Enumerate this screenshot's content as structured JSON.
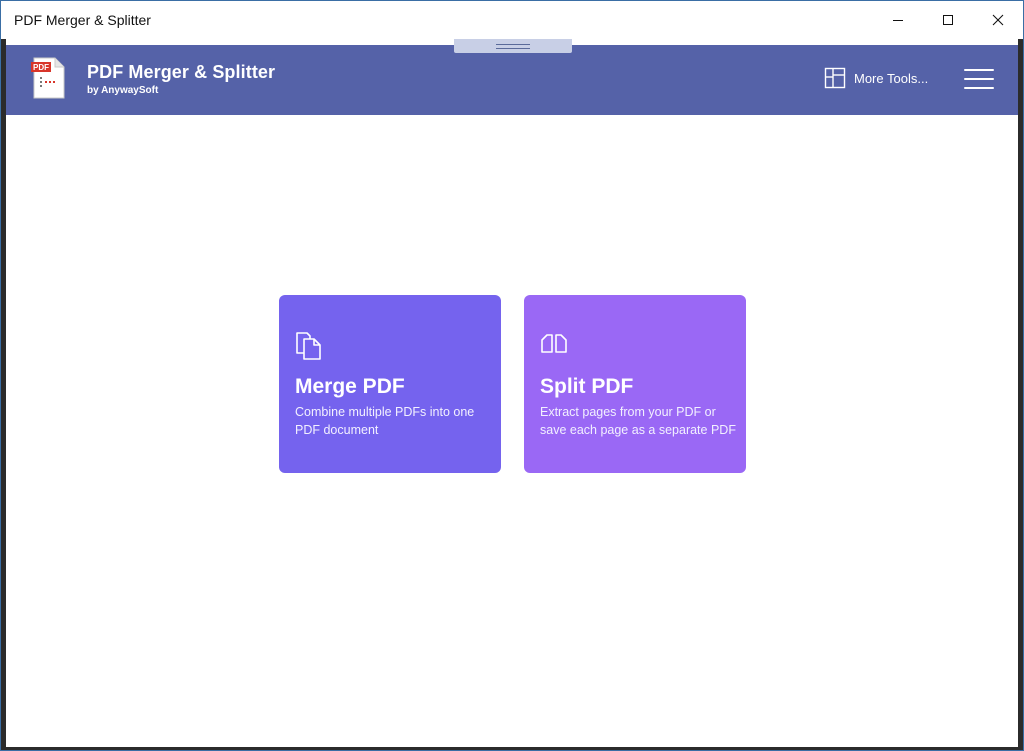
{
  "window": {
    "title": "PDF Merger & Splitter",
    "controls": [
      "minimize-icon",
      "maximize-icon",
      "close-icon"
    ]
  },
  "header": {
    "app_name": "PDF Merger & Splitter",
    "by_line": "by AnywaySoft",
    "logo_text": "PDF",
    "more_tools_label": "More Tools...",
    "more_tools_icon": "layout-grid-icon",
    "menu_icon": "hamburger-menu-icon",
    "background_color": "#5562a8"
  },
  "cards": {
    "merge": {
      "title": "Merge PDF",
      "description": "Combine multiple PDFs into one PDF document",
      "icon": "copy-pages-icon",
      "color": "#7563ee"
    },
    "split": {
      "title": "Split PDF",
      "description": "Extract pages from your PDF or save each page as a separate PDF",
      "icon": "split-pages-icon",
      "color": "#9a68f5"
    }
  }
}
